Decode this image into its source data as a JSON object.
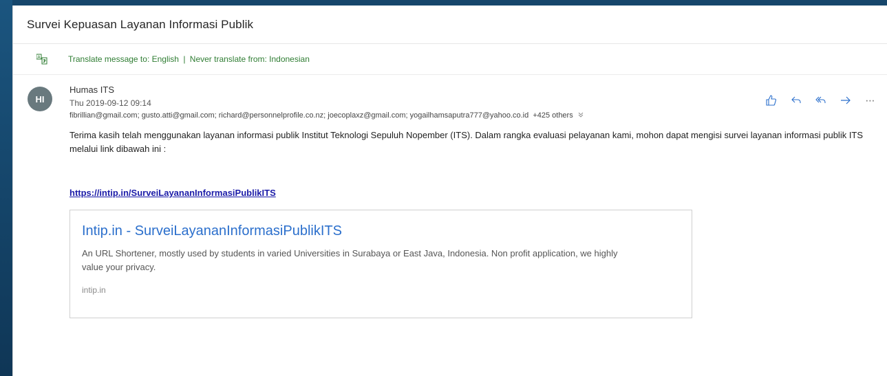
{
  "subject": "Survei Kepuasan Layanan Informasi Publik",
  "translate": {
    "translate_to": "Translate message to: English",
    "separator": "|",
    "never_translate": "Never translate from: Indonesian"
  },
  "message": {
    "avatar_initials": "HI",
    "avatar_color": "#69797e",
    "sender": "Humas ITS",
    "date": "Thu 2019-09-12 09:14",
    "recipients": "fibrillian@gmail.com; gusto.atti@gmail.com; richard@personnelprofile.co.nz; joecoplaxz@gmail.com; yogailhamsaputra777@yahoo.co.id",
    "recipients_more": "+425 others",
    "actions": [
      "like-icon",
      "reply-icon",
      "reply-all-icon",
      "forward-icon",
      "more-icon"
    ]
  },
  "body": {
    "paragraph": "Terima kasih telah menggunakan layanan informasi publik Institut Teknologi Sepuluh Nopember (ITS). Dalam rangka evaluasi pelayanan kami, mohon dapat mengisi survei layanan informasi publik ITS melalui link dibawah ini :",
    "link": "https://intip.in/SurveiLayananInformasiPublikITS"
  },
  "preview_card": {
    "title": "Intip.in - SurveiLayananInformasiPublikITS",
    "description": "An URL Shortener, mostly used by students in varied Universities in Surabaya or East Java, Indonesia. Non profit application, we highly value your privacy.",
    "domain": "intip.in"
  },
  "colors": {
    "accent": "#2b6fcc",
    "translate_green": "#2f7d33",
    "link": "#1b1ba8",
    "background": "#16466b"
  }
}
